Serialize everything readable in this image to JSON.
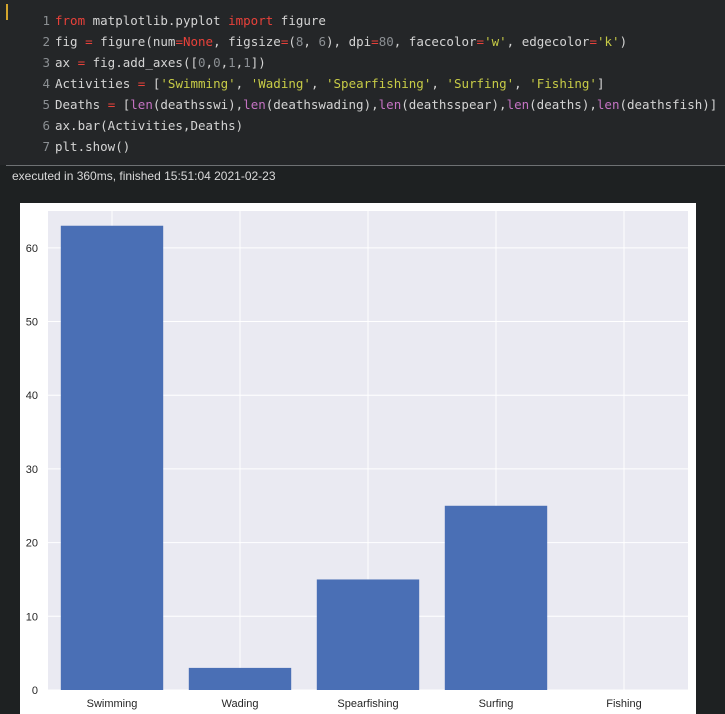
{
  "code_cell": {
    "lines": [
      {
        "num": "1",
        "tokens": [
          [
            "kw",
            "from"
          ],
          [
            "fn",
            " matplotlib.pyplot "
          ],
          [
            "kw",
            "import"
          ],
          [
            "fn",
            " figure"
          ]
        ]
      },
      {
        "num": "2",
        "tokens": [
          [
            "fn",
            "fig "
          ],
          [
            "op",
            "="
          ],
          [
            "fn",
            " figure(num"
          ],
          [
            "op",
            "="
          ],
          [
            "const",
            "None"
          ],
          [
            "fn",
            ", figsize"
          ],
          [
            "op",
            "="
          ],
          [
            "fn",
            "("
          ],
          [
            "num",
            "8"
          ],
          [
            "fn",
            ", "
          ],
          [
            "num",
            "6"
          ],
          [
            "fn",
            "), dpi"
          ],
          [
            "op",
            "="
          ],
          [
            "num",
            "80"
          ],
          [
            "fn",
            ", facecolor"
          ],
          [
            "op",
            "="
          ],
          [
            "str",
            "'w'"
          ],
          [
            "fn",
            ", edgecolor"
          ],
          [
            "op",
            "="
          ],
          [
            "str",
            "'k'"
          ],
          [
            "fn",
            ")"
          ]
        ]
      },
      {
        "num": "3",
        "tokens": [
          [
            "fn",
            "ax "
          ],
          [
            "op",
            "="
          ],
          [
            "fn",
            " fig.add_axes(["
          ],
          [
            "num",
            "0"
          ],
          [
            "fn",
            ","
          ],
          [
            "num",
            "0"
          ],
          [
            "fn",
            ","
          ],
          [
            "num",
            "1"
          ],
          [
            "fn",
            ","
          ],
          [
            "num",
            "1"
          ],
          [
            "fn",
            "])"
          ]
        ]
      },
      {
        "num": "4",
        "tokens": [
          [
            "fn",
            "Activities "
          ],
          [
            "op",
            "="
          ],
          [
            "fn",
            " ["
          ],
          [
            "str",
            "'Swimming'"
          ],
          [
            "fn",
            ", "
          ],
          [
            "str",
            "'Wading'"
          ],
          [
            "fn",
            ", "
          ],
          [
            "str",
            "'Spearfishing'"
          ],
          [
            "fn",
            ", "
          ],
          [
            "str",
            "'Surfing'"
          ],
          [
            "fn",
            ", "
          ],
          [
            "str",
            "'Fishing'"
          ],
          [
            "fn",
            "]"
          ]
        ]
      },
      {
        "num": "5",
        "tokens": [
          [
            "fn",
            "Deaths "
          ],
          [
            "op",
            "="
          ],
          [
            "fn",
            " ["
          ],
          [
            "builtin",
            "len"
          ],
          [
            "fn",
            "(deathsswi),"
          ],
          [
            "builtin",
            "len"
          ],
          [
            "fn",
            "(deathswading),"
          ],
          [
            "builtin",
            "len"
          ],
          [
            "fn",
            "(deathsspear),"
          ],
          [
            "builtin",
            "len"
          ],
          [
            "fn",
            "(deaths),"
          ],
          [
            "builtin",
            "len"
          ],
          [
            "fn",
            "(deathsfish)]"
          ]
        ]
      },
      {
        "num": "6",
        "tokens": [
          [
            "fn",
            "ax.bar(Activities,Deaths)"
          ]
        ]
      },
      {
        "num": "7",
        "tokens": [
          [
            "fn",
            "plt.show()"
          ]
        ]
      }
    ]
  },
  "exec_info": "executed in 360ms, finished 15:51:04 2021-02-23",
  "chart_data": {
    "type": "bar",
    "categories": [
      "Swimming",
      "Wading",
      "Spearfishing",
      "Surfing",
      "Fishing"
    ],
    "values": [
      63,
      3,
      15,
      25,
      0
    ],
    "ylim": [
      0,
      65
    ],
    "yticks": [
      0,
      10,
      20,
      30,
      40,
      50,
      60
    ],
    "bar_color": "#4a6fb5",
    "axes_bg": "#eaeaf2",
    "grid": true
  }
}
